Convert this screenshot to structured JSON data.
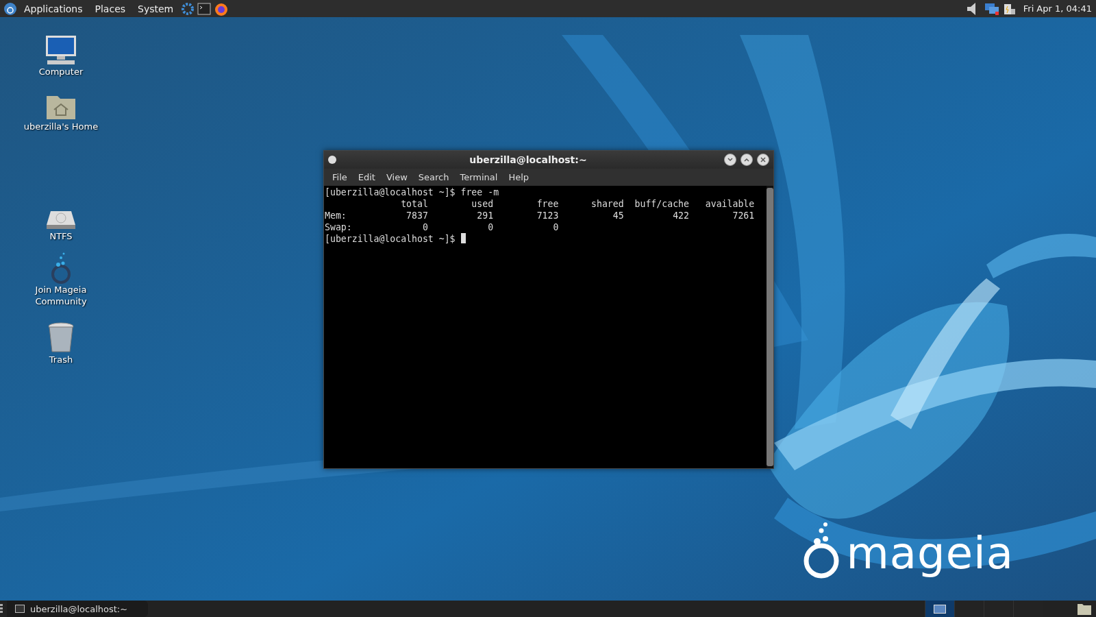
{
  "top_panel": {
    "menus": [
      "Applications",
      "Places",
      "System"
    ],
    "clock": "Fri Apr  1, 04:41"
  },
  "desktop_icons": [
    {
      "kind": "computer",
      "label": "Computer"
    },
    {
      "kind": "home",
      "label": "uberzilla's Home"
    },
    {
      "kind": "drive",
      "label": "NTFS"
    },
    {
      "kind": "community",
      "label": "Join Mageia Community"
    },
    {
      "kind": "trash",
      "label": "Trash"
    }
  ],
  "wallpaper_logo": "mageia",
  "terminal": {
    "title": "uberzilla@localhost:~",
    "menu": [
      "File",
      "Edit",
      "View",
      "Search",
      "Terminal",
      "Help"
    ],
    "lines": [
      "[uberzilla@localhost ~]$ free -m",
      "              total        used        free      shared  buff/cache   available",
      "Mem:           7837         291        7123          45         422        7261",
      "Swap:             0           0           0"
    ],
    "prompt": "[uberzilla@localhost ~]$ "
  },
  "bottom_panel": {
    "tasks": [
      {
        "label": "uberzilla@localhost:~"
      }
    ],
    "workspaces": [
      {
        "selected": true
      },
      {
        "selected": false
      },
      {
        "selected": false
      },
      {
        "selected": false
      }
    ]
  }
}
